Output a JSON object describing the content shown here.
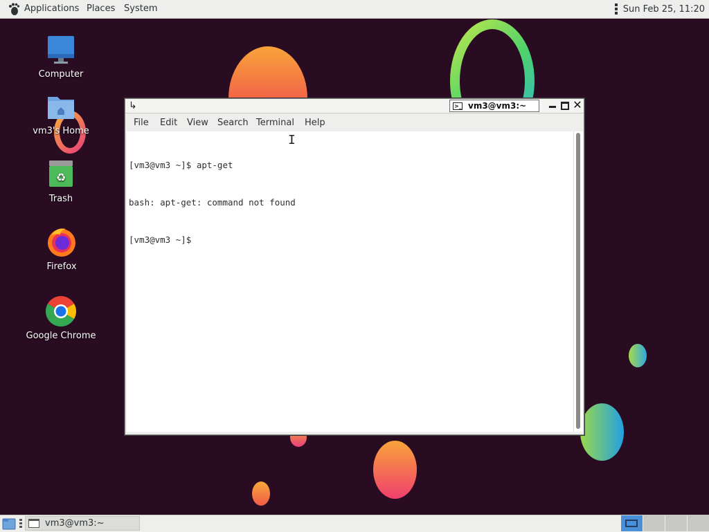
{
  "top_panel": {
    "menus": [
      "Applications",
      "Places",
      "System"
    ],
    "clock": "Sun Feb 25, 11:20"
  },
  "desktop": {
    "icons": [
      {
        "label": "Computer",
        "icon": "computer-icon"
      },
      {
        "label": "vm3's Home",
        "icon": "home-folder-icon"
      },
      {
        "label": "Trash",
        "icon": "trash-icon"
      },
      {
        "label": "Firefox",
        "icon": "firefox-icon"
      },
      {
        "label": "Google Chrome",
        "icon": "chrome-icon"
      }
    ]
  },
  "terminal": {
    "title": "vm3@vm3:~",
    "menu": [
      "File",
      "Edit",
      "View",
      "Search",
      "Terminal",
      "Help"
    ],
    "lines": [
      "[vm3@vm3 ~]$ apt-get",
      "bash: apt-get: command not found",
      "[vm3@vm3 ~]$ "
    ]
  },
  "bottom_panel": {
    "task_label": "vm3@vm3:~",
    "workspace_count": 4,
    "active_workspace": 1
  },
  "colors": {
    "desktop_bg": "#2a0c22",
    "panel_bg": "#eeeeec",
    "accent": "#4a90d9"
  }
}
